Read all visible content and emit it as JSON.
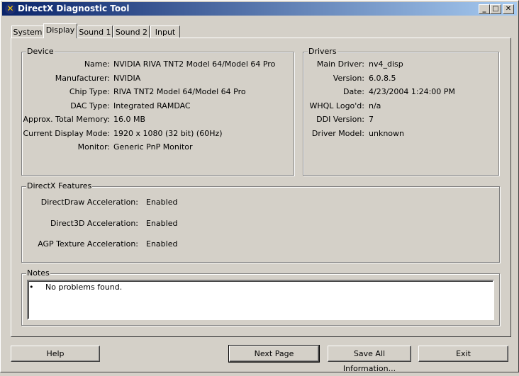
{
  "window": {
    "title": "DirectX Diagnostic Tool",
    "minimize": "_",
    "maximize": "□",
    "close": "✕"
  },
  "tabs": [
    {
      "label": "System"
    },
    {
      "label": "Display"
    },
    {
      "label": "Sound 1"
    },
    {
      "label": "Sound 2"
    },
    {
      "label": "Input"
    }
  ],
  "device": {
    "title": "Device",
    "rows": [
      {
        "label": "Name:",
        "value": "NVIDIA RIVA TNT2 Model 64/Model 64 Pro"
      },
      {
        "label": "Manufacturer:",
        "value": "NVIDIA"
      },
      {
        "label": "Chip Type:",
        "value": "RIVA TNT2 Model 64/Model 64 Pro"
      },
      {
        "label": "DAC Type:",
        "value": "Integrated RAMDAC"
      },
      {
        "label": "Approx. Total Memory:",
        "value": "16.0 MB"
      },
      {
        "label": "Current Display Mode:",
        "value": "1920 x 1080 (32 bit) (60Hz)"
      },
      {
        "label": "Monitor:",
        "value": "Generic PnP Monitor"
      }
    ]
  },
  "drivers": {
    "title": "Drivers",
    "rows": [
      {
        "label": "Main Driver:",
        "value": "nv4_disp"
      },
      {
        "label": "Version:",
        "value": "6.0.8.5"
      },
      {
        "label": "Date:",
        "value": "4/23/2004 1:24:00 PM"
      },
      {
        "label": "WHQL Logo'd:",
        "value": "n/a"
      },
      {
        "label": "DDI Version:",
        "value": "7"
      },
      {
        "label": "Driver Model:",
        "value": "unknown"
      }
    ]
  },
  "features": {
    "title": "DirectX Features",
    "rows": [
      {
        "label": "DirectDraw Acceleration:",
        "value": "Enabled"
      },
      {
        "label": "Direct3D Acceleration:",
        "value": "Enabled"
      },
      {
        "label": "AGP Texture Acceleration:",
        "value": "Enabled"
      }
    ]
  },
  "notes": {
    "title": "Notes",
    "bullet": "•",
    "items": [
      "No problems found."
    ]
  },
  "buttons": {
    "help": "Help",
    "next": "Next Page",
    "save": "Save All Information...",
    "exit": "Exit"
  }
}
